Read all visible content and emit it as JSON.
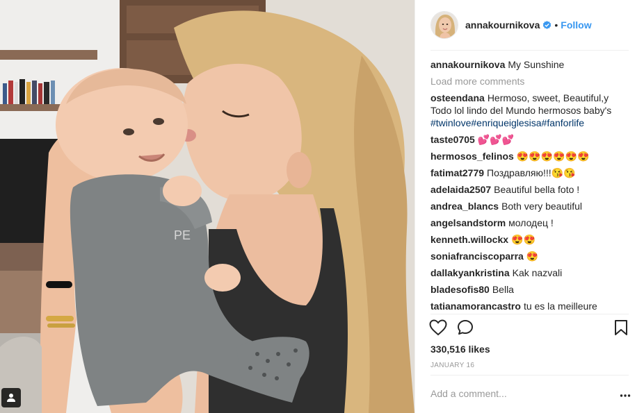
{
  "post": {
    "author": "annakournikova",
    "verified": true,
    "follow_label": "Follow",
    "separator": "•"
  },
  "comments": {
    "caption": {
      "user": "annakournikova",
      "text": "My Sunshine"
    },
    "load_more": "Load more comments",
    "items": [
      {
        "user": "osteendana",
        "text": "Hermoso, sweet, Beautiful,y Todo lol lindo del Mundo hermosos baby's ",
        "hashtags": "#twinlove#enriqueiglesisa#fanforlife"
      },
      {
        "user": "taste0705",
        "text": "💕💕💕"
      },
      {
        "user": "hermosos_felinos",
        "text": "😍😍😍😍😍😍"
      },
      {
        "user": "fatimat2779",
        "text": "Поздравляю!!!😘😘"
      },
      {
        "user": "adelaida2507",
        "text": "Beautiful bella foto !"
      },
      {
        "user": "andrea_blancs",
        "text": "Both very beautiful"
      },
      {
        "user": "angelsandstorm",
        "text": "молодец !"
      },
      {
        "user": "kenneth.willockx",
        "text": "😍😍"
      },
      {
        "user": "soniafranciscoparra",
        "text": "😍"
      },
      {
        "user": "dallakyankristina",
        "text": "Kak nazvali"
      },
      {
        "user": "bladesofis80",
        "text": "Bella"
      },
      {
        "user": "tatianamorancastro",
        "text": "tu es la meilleure"
      }
    ]
  },
  "actions": {
    "like_icon": "heart-outline-icon",
    "comment_icon": "speech-bubble-icon",
    "save_icon": "bookmark-icon",
    "likes_text": "330,516 likes",
    "date": "JANUARY 16"
  },
  "composer": {
    "placeholder": "Add a comment...",
    "more_icon": "ellipsis-icon"
  },
  "colors": {
    "link_blue": "#3897f0",
    "hashtag": "#003569",
    "muted": "#999999",
    "text": "#262626"
  }
}
